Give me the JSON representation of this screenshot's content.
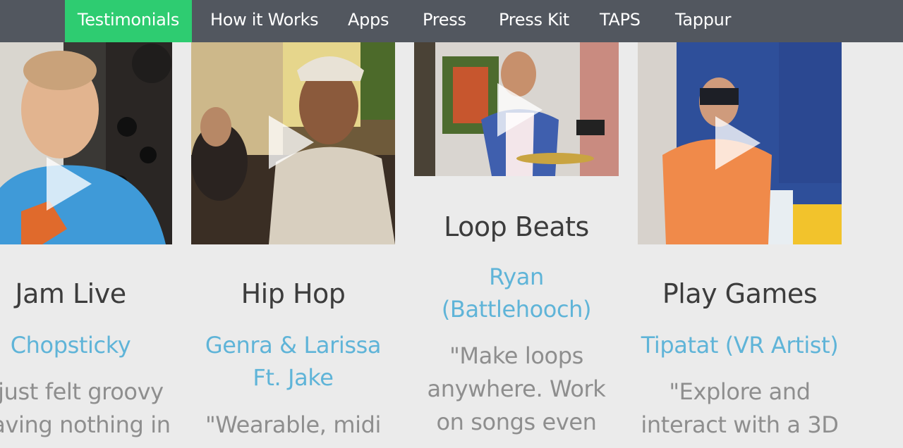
{
  "nav": {
    "items": [
      {
        "label": "Testimonials",
        "active": true
      },
      {
        "label": "How it Works"
      },
      {
        "label": "Apps"
      },
      {
        "label": "Press"
      },
      {
        "label": "Press Kit"
      },
      {
        "label": "TAPS"
      },
      {
        "label": "Tappur"
      }
    ],
    "active_color": "#2ecc71",
    "bar_color": "#52575f"
  },
  "cards": [
    {
      "title": "Jam Live",
      "artist": "Chopsticky",
      "quote": "I just felt groovy having nothing in",
      "video_icon": "play-icon"
    },
    {
      "title": "Hip Hop",
      "artist": "Genra & Larissa Ft. Jake",
      "quote": "\"Wearable, midi",
      "video_icon": "play-icon"
    },
    {
      "title": "Loop Beats",
      "artist": "Ryan (Battlehooch)",
      "quote": "\"Make loops anywhere. Work on songs even",
      "video_icon": "play-icon"
    },
    {
      "title": "Play Games",
      "artist": "Tipatat (VR Artist)",
      "quote": "\"Explore and interact with a 3D",
      "video_icon": "play-icon"
    }
  ],
  "colors": {
    "background": "#ebebeb",
    "title": "#3c3c3c",
    "artist_link": "#5fb4d8",
    "quote": "#8e8e8e"
  }
}
